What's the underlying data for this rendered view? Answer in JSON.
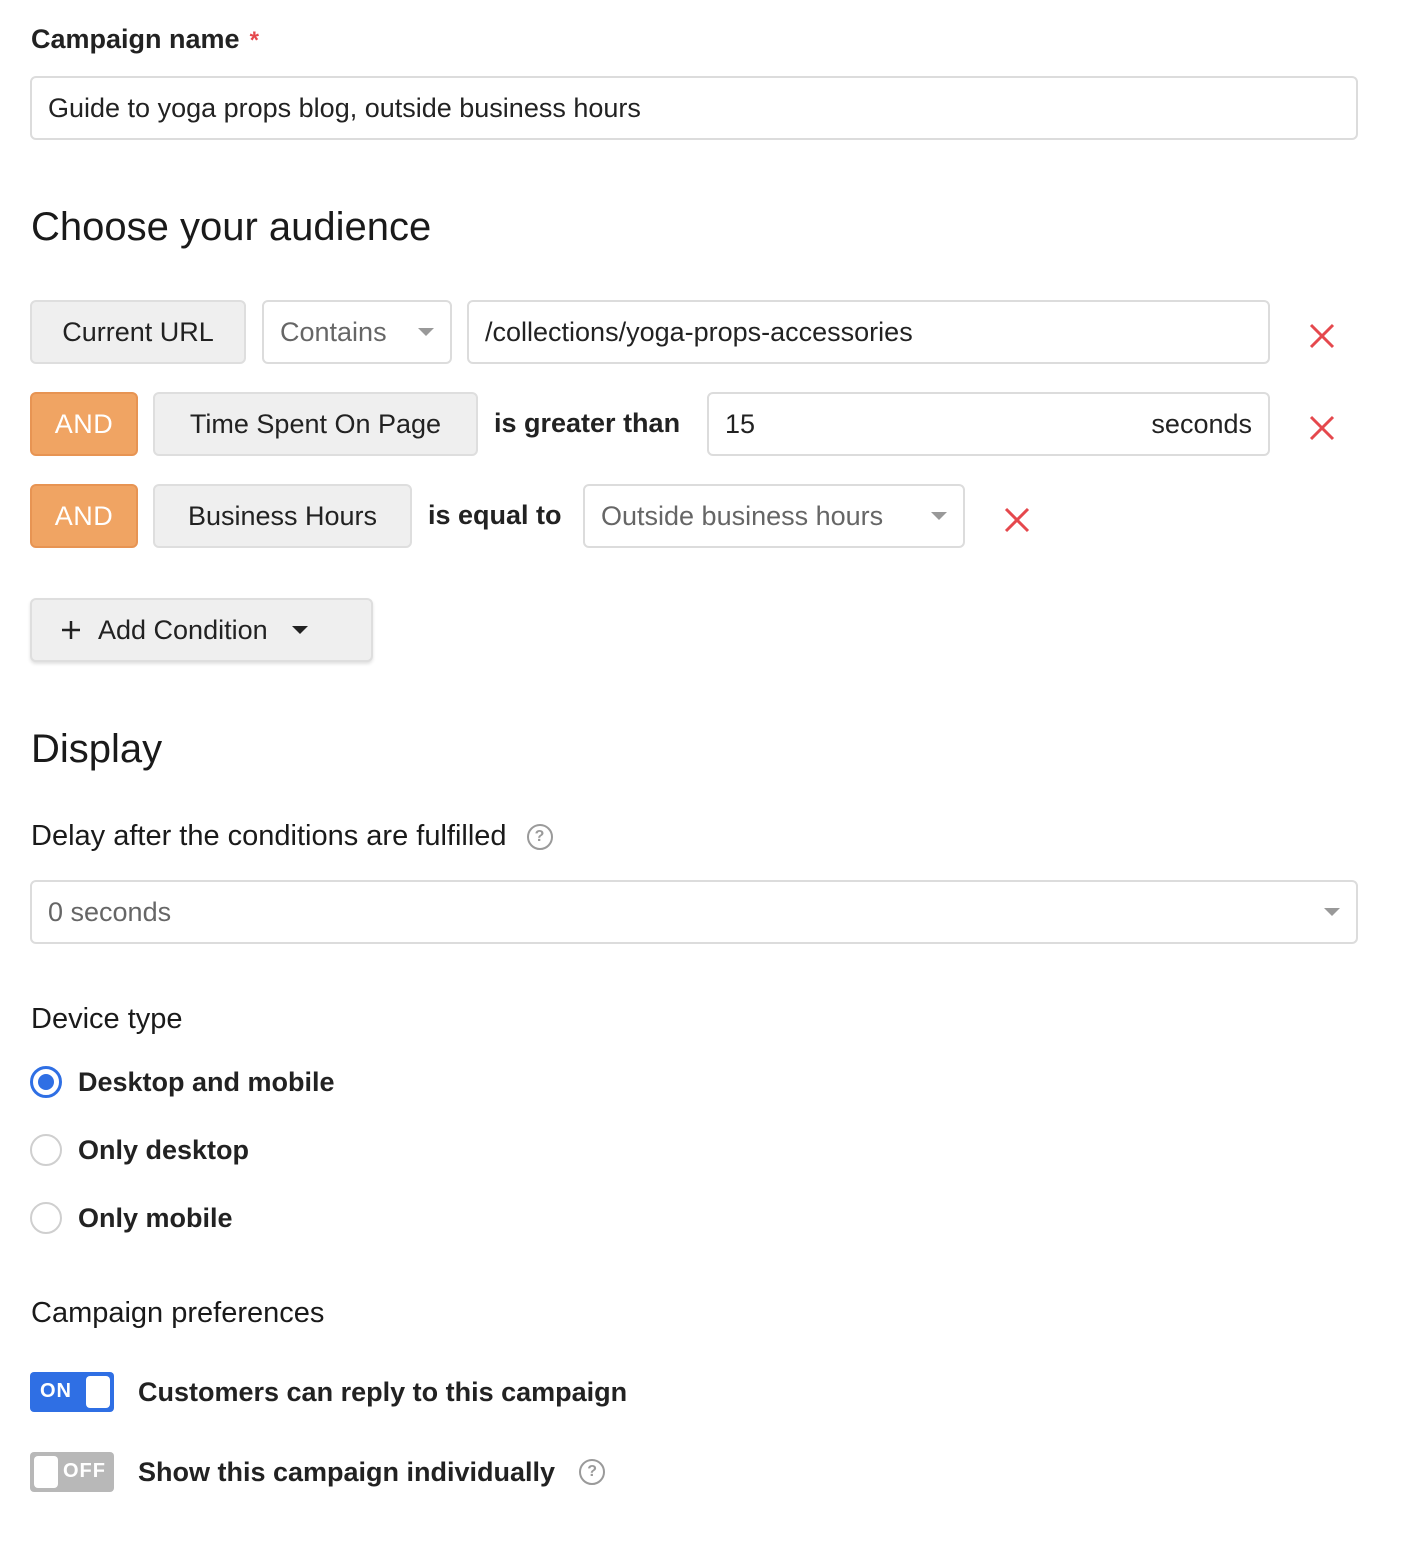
{
  "campaign_name": {
    "label": "Campaign name",
    "required_mark": "*",
    "value": "Guide to yoga props blog, outside business hours"
  },
  "audience": {
    "heading": "Choose your audience",
    "conditions": [
      {
        "field": "Current URL",
        "operator": "Contains",
        "value": "/collections/yoga-props-accessories"
      },
      {
        "connector": "AND",
        "field": "Time Spent On Page",
        "operator": "is greater than",
        "value": "15",
        "unit": "seconds"
      },
      {
        "connector": "AND",
        "field": "Business Hours",
        "operator": "is equal to",
        "value": "Outside business hours"
      }
    ],
    "add_condition_label": "Add Condition",
    "remove_color": "#e5484d"
  },
  "display": {
    "heading": "Display",
    "delay_label": "Delay after the conditions are fulfilled",
    "delay_value": "0 seconds",
    "help_glyph": "?",
    "device_type_label": "Device type",
    "device_options": [
      "Desktop and mobile",
      "Only desktop",
      "Only mobile"
    ],
    "device_selected": "Desktop and mobile"
  },
  "preferences": {
    "heading": "Campaign preferences",
    "items": [
      {
        "state_label": "ON",
        "label": "Customers can reply to this campaign",
        "on": true
      },
      {
        "state_label": "OFF",
        "label": "Show this campaign individually",
        "on": false
      }
    ]
  },
  "colors": {
    "accent": "#2f6fe4",
    "and_badge": "#f0a463"
  }
}
